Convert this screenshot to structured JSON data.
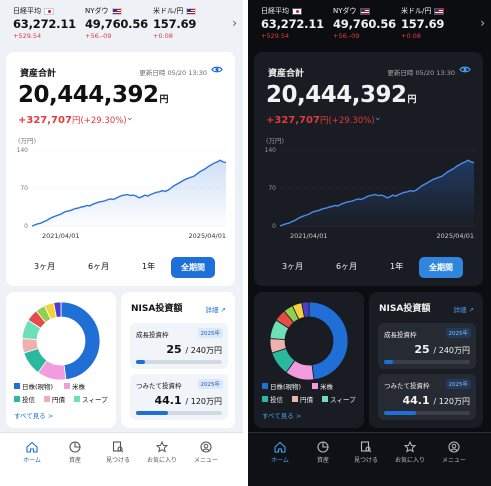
{
  "ticker": [
    {
      "name": "日経平均",
      "flag": "jp",
      "value": "63,272.11",
      "change": "+529.54"
    },
    {
      "name": "NYダウ",
      "flag": "us",
      "value": "49,760.56",
      "change": "+56.-09"
    },
    {
      "name": "米ドル/円",
      "flag": "us",
      "value": "157.69",
      "change": "+0.08"
    }
  ],
  "asset": {
    "title": "資産合計",
    "updated": "更新日時 05/20 13:30",
    "total": "20,444,392",
    "total_unit": "円",
    "gain": "+327,707",
    "gain_unit": "円",
    "gain_pct": "(+29.30%)",
    "unit_label": "(万円)"
  },
  "chart_data": {
    "type": "area",
    "x_labels": [
      "2021/04/01",
      "2025/04/01"
    ],
    "ylim": [
      0,
      140
    ],
    "yticks": [
      0,
      70,
      140
    ],
    "values": [
      0,
      2,
      4,
      5,
      8,
      10,
      13,
      16,
      18,
      20,
      22,
      25,
      27,
      28,
      30,
      32,
      33,
      35,
      36,
      38,
      37,
      40,
      42,
      44,
      45,
      46,
      48,
      50,
      49,
      51,
      54,
      56,
      57,
      58,
      56,
      57,
      55,
      52,
      54,
      57,
      55,
      58,
      60,
      62,
      63,
      65,
      64,
      66,
      70,
      74,
      77,
      80,
      83,
      86,
      88,
      90,
      92,
      96,
      100,
      103,
      106,
      110,
      113,
      116,
      118,
      121,
      118,
      117
    ],
    "grid": true
  },
  "ranges": [
    "3ヶ月",
    "6ヶ月",
    "1年",
    "全期間"
  ],
  "allocation": {
    "slices": [
      {
        "label": "日株(現物)",
        "value": 48,
        "color": "#1f6fd6"
      },
      {
        "label": "米株",
        "value": 12,
        "color": "#f29ce0"
      },
      {
        "label": "投信",
        "value": 10,
        "color": "#2ab89e"
      },
      {
        "label": "円債",
        "value": 6,
        "color": "#f1b0b0"
      },
      {
        "label": "スィープ",
        "value": 8,
        "color": "#6de0b8"
      },
      {
        "label": "",
        "value": 5,
        "color": "#e84a4a"
      },
      {
        "label": "",
        "value": 4,
        "color": "#8fd14f"
      },
      {
        "label": "",
        "value": 4,
        "color": "#f3d23a"
      },
      {
        "label": "",
        "value": 3,
        "color": "#4f3cc9"
      }
    ],
    "more_label": "すべて見る >"
  },
  "nisa": {
    "title": "NISA投資額",
    "detail_label": "詳細",
    "growth": {
      "label": "成長投資枠",
      "year": "2025年",
      "amount": "25",
      "limit": "/ 240",
      "unit": "万円",
      "fill": 0.104
    },
    "tsumitate": {
      "label": "つみたて投資枠",
      "year": "2025年",
      "amount": "44.1",
      "limit": "/ 120",
      "unit": "万円",
      "fill": 0.368
    }
  },
  "nav": [
    "ホーム",
    "資産",
    "見つける",
    "お気に入り",
    "メニュー"
  ],
  "colors": {
    "accent": "#1e6fd9",
    "gain": "#e23b3b",
    "line": "#2e72d8"
  }
}
